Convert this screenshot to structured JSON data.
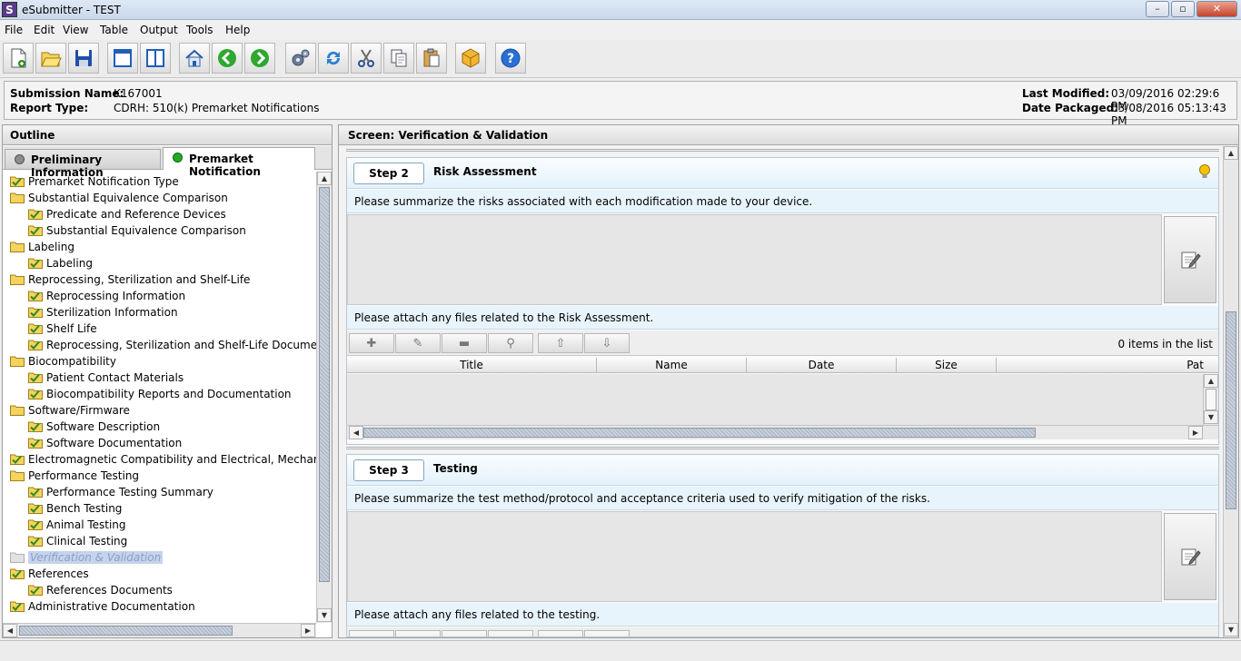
{
  "window": {
    "title": "eSubmitter - TEST",
    "app_icon_letter": "S",
    "minimize_glyph": "–",
    "maximize_glyph": "▫",
    "close_glyph": "✕"
  },
  "menu": [
    "File",
    "Edit",
    "View",
    "Table",
    "Output",
    "Tools",
    "Help"
  ],
  "toolbar": {
    "buttons": [
      "new-document-icon",
      "open-folder-icon",
      "save-disk-icon",
      "window-cascade-icon",
      "window-split-icon",
      "home-icon",
      "back-arrow-icon",
      "forward-arrow-icon",
      "gears-icon",
      "refresh-icon",
      "cut-scissors-icon",
      "copy-icon",
      "paste-icon",
      "package-box-icon",
      "help-icon"
    ]
  },
  "info": {
    "submission_name_label": "Submission Name:",
    "submission_name": "K167001",
    "report_type_label": "Report Type:",
    "report_type": "CDRH: 510(k) Premarket Notifications",
    "last_modified_label": "Last Modified:",
    "last_modified": "03/09/2016 02:29:6 PM",
    "date_packaged_label": "Date Packaged:",
    "date_packaged": "03/08/2016 05:13:43 PM"
  },
  "outline": {
    "header": "Outline",
    "tabs": [
      {
        "label": "Preliminary Information",
        "status_color": "#8c8c8c"
      },
      {
        "label": "Premarket Notification",
        "status_color": "#22aa22"
      }
    ],
    "tree": [
      {
        "label": "Premarket Notification Type",
        "level": 0,
        "icon": "folder-check"
      },
      {
        "label": "Substantial Equivalence Comparison",
        "level": 0,
        "icon": "folder"
      },
      {
        "label": "Predicate and Reference Devices",
        "level": 1,
        "icon": "folder-check"
      },
      {
        "label": "Substantial Equivalence Comparison",
        "level": 1,
        "icon": "folder-check"
      },
      {
        "label": "Labeling",
        "level": 0,
        "icon": "folder"
      },
      {
        "label": "Labeling",
        "level": 1,
        "icon": "folder-check"
      },
      {
        "label": "Reprocessing, Sterilization and Shelf-Life",
        "level": 0,
        "icon": "folder"
      },
      {
        "label": "Reprocessing Information",
        "level": 1,
        "icon": "folder-check"
      },
      {
        "label": "Sterilization Information",
        "level": 1,
        "icon": "folder-check"
      },
      {
        "label": "Shelf Life",
        "level": 1,
        "icon": "folder-check"
      },
      {
        "label": "Reprocessing, Sterilization and Shelf-Life Documentat",
        "level": 1,
        "icon": "folder-check"
      },
      {
        "label": "Biocompatibility",
        "level": 0,
        "icon": "folder"
      },
      {
        "label": "Patient Contact Materials",
        "level": 1,
        "icon": "folder-check"
      },
      {
        "label": "Biocompatibility Reports and Documentation",
        "level": 1,
        "icon": "folder-check"
      },
      {
        "label": "Software/Firmware",
        "level": 0,
        "icon": "folder"
      },
      {
        "label": "Software Description",
        "level": 1,
        "icon": "folder-check"
      },
      {
        "label": "Software Documentation",
        "level": 1,
        "icon": "folder-check"
      },
      {
        "label": "Electromagnetic Compatibility and Electrical, Mechanical a",
        "level": 0,
        "icon": "folder-check"
      },
      {
        "label": "Performance Testing",
        "level": 0,
        "icon": "folder"
      },
      {
        "label": "Performance Testing Summary",
        "level": 1,
        "icon": "folder-check"
      },
      {
        "label": "Bench Testing",
        "level": 1,
        "icon": "folder-check"
      },
      {
        "label": "Animal Testing",
        "level": 1,
        "icon": "folder-check"
      },
      {
        "label": "Clinical Testing",
        "level": 1,
        "icon": "folder-check"
      },
      {
        "label": "Verification & Validation",
        "level": 0,
        "icon": "folder-empty",
        "selected": true
      },
      {
        "label": "References",
        "level": 0,
        "icon": "folder-check"
      },
      {
        "label": "References Documents",
        "level": 1,
        "icon": "folder-check"
      },
      {
        "label": "Administrative Documentation",
        "level": 0,
        "icon": "folder-check"
      }
    ]
  },
  "screen": {
    "header": "Screen: Verification & Validation",
    "steps": [
      {
        "button": "Step 2",
        "title": "Risk Assessment",
        "prompt": "Please summarize the risks associated with each modification made to your device.",
        "attach_prompt": "Please attach any files related to the Risk Assessment.",
        "item_count": "0 items in the list",
        "columns": [
          "Title",
          "Name",
          "Date",
          "Size",
          "Pat"
        ]
      },
      {
        "button": "Step 3",
        "title": "Testing",
        "prompt": "Please summarize the test method/protocol and acceptance criteria used to verify mitigation of the risks.",
        "attach_prompt": "Please attach any files related to the testing."
      }
    ],
    "table_buttons": [
      "add-plus-icon",
      "edit-pencil-icon",
      "remove-minus-icon",
      "view-magnifier-icon",
      "move-up-icon",
      "move-down-icon"
    ]
  },
  "colors": {
    "check_green": "#2e8b1e",
    "folder_yellow": "#f4d35e",
    "hint_bulb": "#f5c400"
  }
}
